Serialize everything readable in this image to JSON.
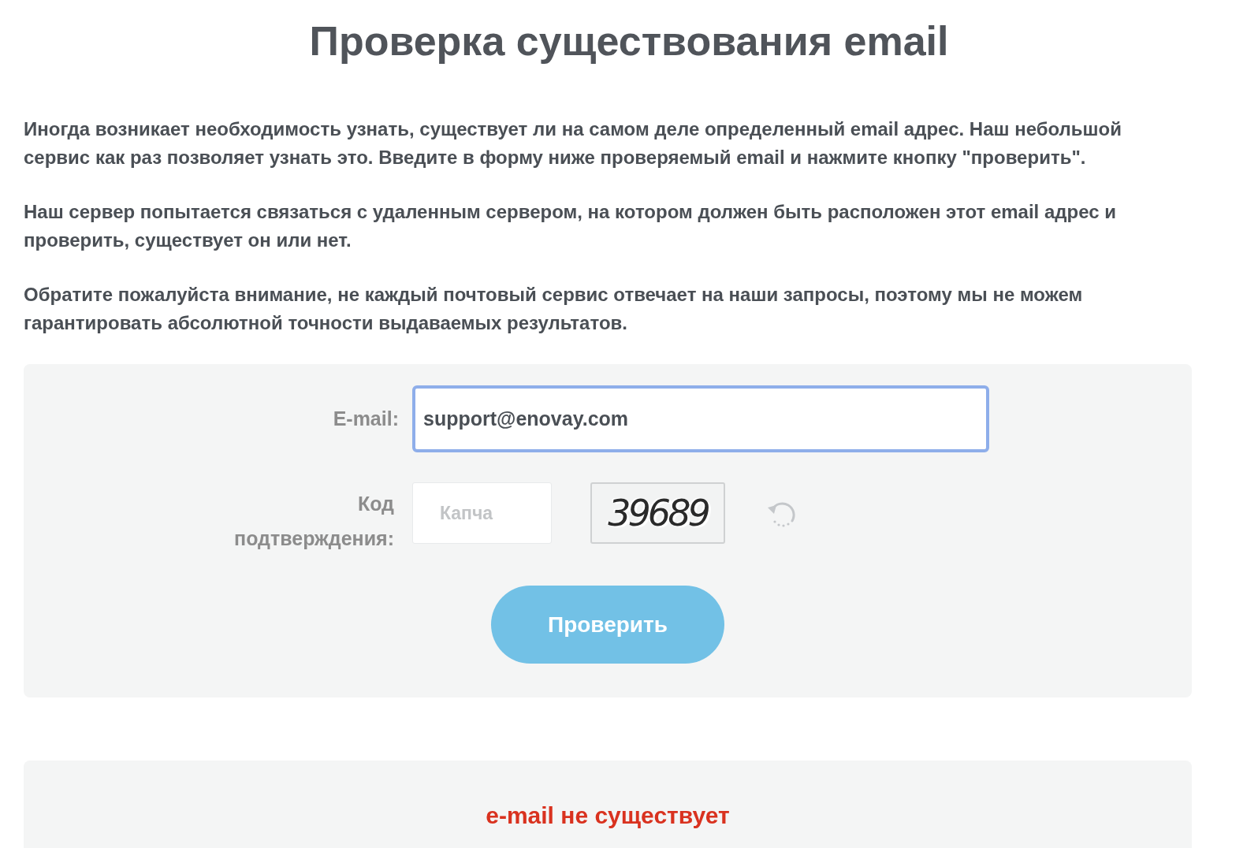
{
  "title": "Проверка существования email",
  "paragraphs": [
    "Иногда возникает необходимость узнать, существует ли на самом деле определенный email адрес. Наш небольшой сервис как раз позволяет узнать это. Введите в форму ниже проверяемый email и нажмите кнопку \"проверить\".",
    "Наш сервер попытается связаться с удаленным сервером, на котором должен быть расположен этот email адрес и проверить, существует он или нет.",
    "Обратите пожалуйста внимание, не каждый почтовый сервис отвечает на наши запросы, поэтому мы не можем гарантировать абсолютной точности выдаваемых результатов."
  ],
  "form": {
    "email": {
      "label": "E-mail:",
      "value": "support@enovay.com",
      "focused": true
    },
    "captcha": {
      "label": "Код подтверждения:",
      "placeholder": "Капча",
      "image_text": "39689"
    },
    "submit": "Проверить"
  },
  "result": {
    "text": "e-mail не существует",
    "exists": false
  }
}
